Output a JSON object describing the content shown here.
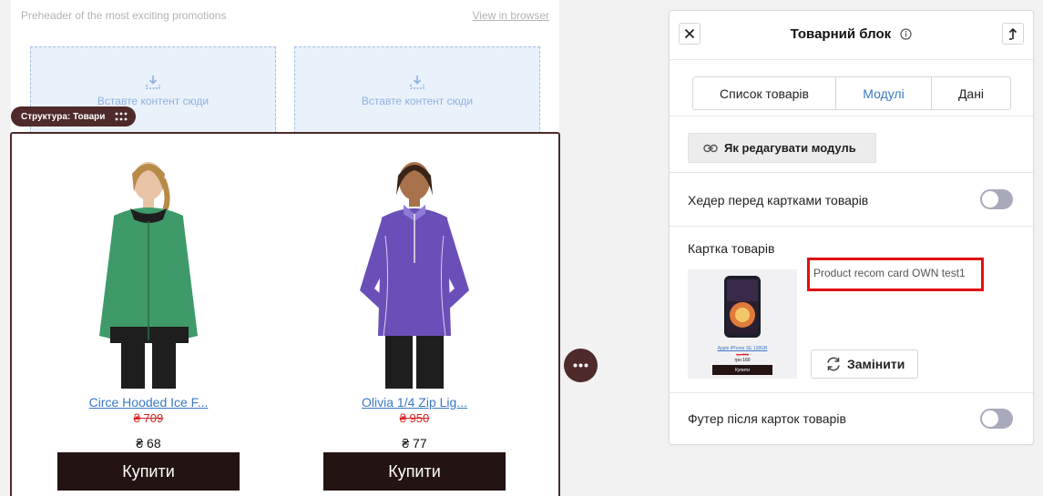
{
  "email": {
    "preheader": "Preheader of the most exciting promotions",
    "view_in_browser": "View in browser",
    "dropzones": [
      {
        "text": "Вставте контент сюди"
      },
      {
        "text": "Вставте контент сюди"
      }
    ],
    "structure_badge": "Структура: Товари",
    "products": [
      {
        "name": "Circe Hooded Ice F...",
        "old_price": "₴ 709",
        "price": "₴ 68",
        "buy_label": "Купити",
        "shirt_color": "#3f9a6a"
      },
      {
        "name": "Olivia 1/4 Zip Lig...",
        "old_price": "₴ 950",
        "price": "₴ 77",
        "buy_label": "Купити",
        "shirt_color": "#6a4fb8"
      }
    ]
  },
  "panel": {
    "title": "Товарний блок",
    "tabs": [
      {
        "label": "Список товарів",
        "active": false
      },
      {
        "label": "Модулі",
        "active": true
      },
      {
        "label": "Дані",
        "active": false
      }
    ],
    "edit_module_label": "Як редагувати модуль",
    "header_toggle": {
      "label": "Хедер перед картками товарів",
      "on": false
    },
    "card": {
      "label": "Картка товарів",
      "name": "Product recom card OWN test1",
      "replace_label": "Замінити",
      "preview": {
        "name": "Apple iPhone SE 128GB",
        "old_price": "грн 200",
        "price": "грн 160",
        "buy_label": "Купити"
      }
    },
    "footer_toggle": {
      "label": "Футер після карток товарів",
      "on": false
    }
  },
  "colors": {
    "accent": "#3a78c4",
    "brand_dark": "#4e2a2a",
    "buy_button": "#241313",
    "old_price": "#d62020",
    "highlight_border": "#e21010"
  }
}
